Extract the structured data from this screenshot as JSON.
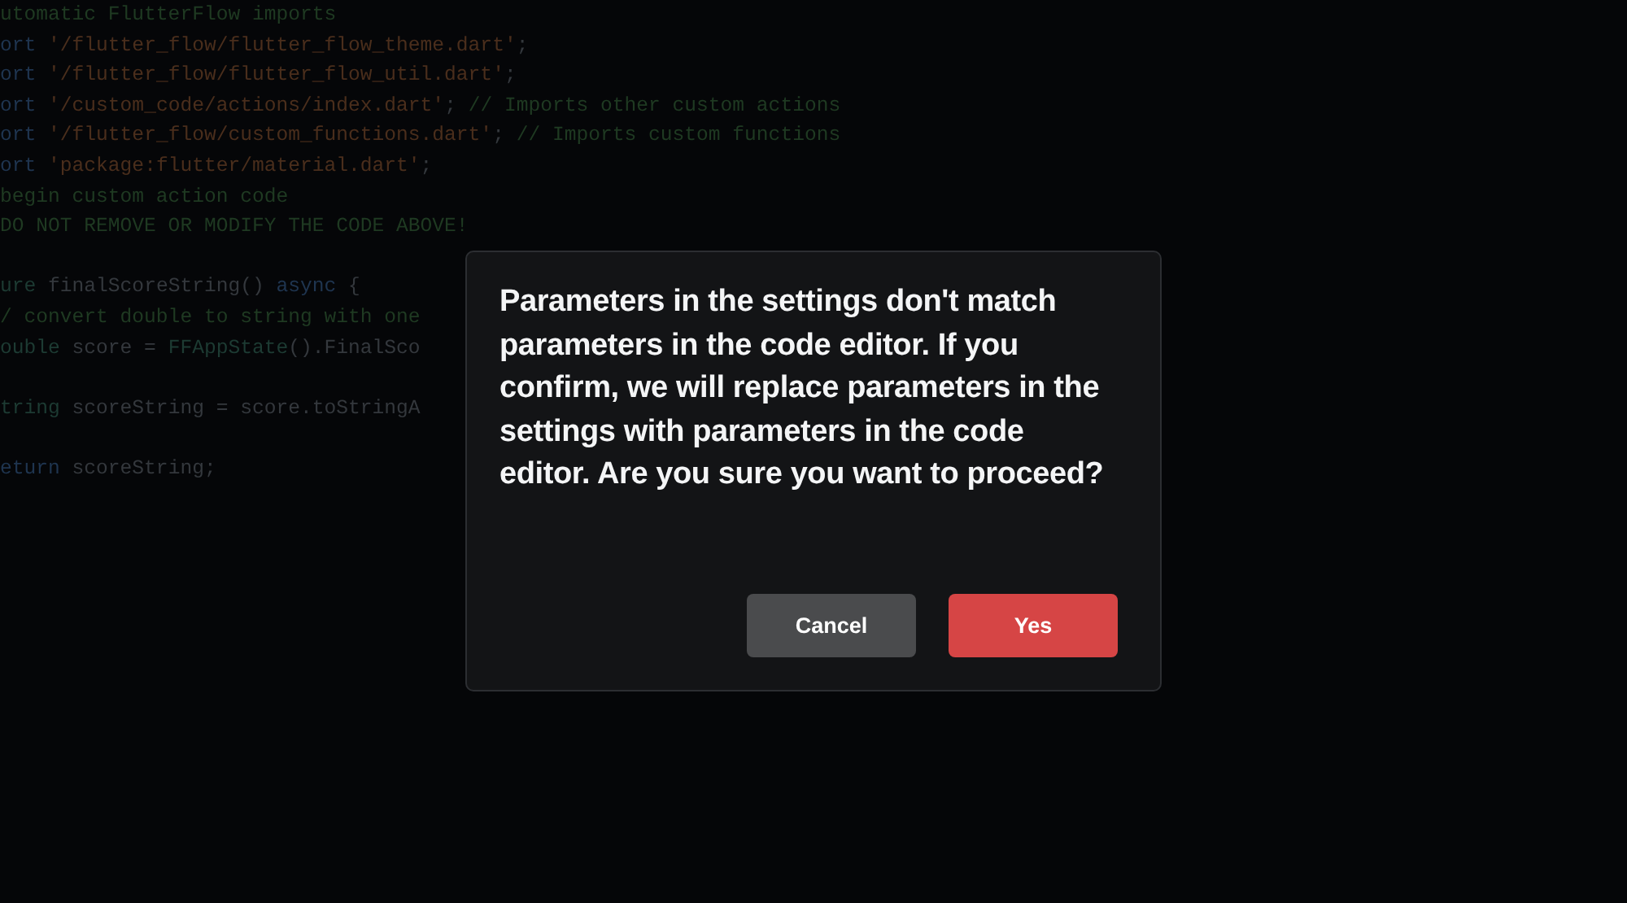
{
  "code_lines": [
    {
      "kind": "code",
      "segments": [
        {
          "kind": "comment",
          "text": "utomatic FlutterFlow imports"
        }
      ]
    },
    {
      "kind": "code",
      "segments": [
        {
          "kind": "keyword",
          "text": "ort "
        },
        {
          "kind": "string",
          "text": "'/flutter_flow/flutter_flow_theme.dart'"
        },
        {
          "kind": "plain",
          "text": ";"
        }
      ]
    },
    {
      "kind": "code",
      "segments": [
        {
          "kind": "keyword",
          "text": "ort "
        },
        {
          "kind": "string",
          "text": "'/flutter_flow/flutter_flow_util.dart'"
        },
        {
          "kind": "plain",
          "text": ";"
        }
      ]
    },
    {
      "kind": "code",
      "segments": [
        {
          "kind": "keyword",
          "text": "ort "
        },
        {
          "kind": "string",
          "text": "'/custom_code/actions/index.dart'"
        },
        {
          "kind": "plain",
          "text": "; "
        },
        {
          "kind": "comment",
          "text": "// Imports other custom actions"
        }
      ]
    },
    {
      "kind": "code",
      "segments": [
        {
          "kind": "keyword",
          "text": "ort "
        },
        {
          "kind": "string",
          "text": "'/flutter_flow/custom_functions.dart'"
        },
        {
          "kind": "plain",
          "text": "; "
        },
        {
          "kind": "comment",
          "text": "// Imports custom functions"
        }
      ]
    },
    {
      "kind": "code",
      "segments": [
        {
          "kind": "keyword",
          "text": "ort "
        },
        {
          "kind": "string",
          "text": "'package:flutter/material.dart'"
        },
        {
          "kind": "plain",
          "text": ";"
        }
      ]
    },
    {
      "kind": "code",
      "segments": [
        {
          "kind": "comment",
          "text": "begin custom action code"
        }
      ]
    },
    {
      "kind": "code",
      "segments": [
        {
          "kind": "comment",
          "text": "DO NOT REMOVE OR MODIFY THE CODE ABOVE!"
        }
      ]
    },
    {
      "kind": "blank"
    },
    {
      "kind": "code",
      "segments": [
        {
          "kind": "type",
          "text": "ure "
        },
        {
          "kind": "plain",
          "text": "finalScoreString() "
        },
        {
          "kind": "keyword",
          "text": "async"
        },
        {
          "kind": "plain",
          "text": " {"
        }
      ]
    },
    {
      "kind": "code",
      "segments": [
        {
          "kind": "comment",
          "text": "/ convert double to string with one"
        }
      ]
    },
    {
      "kind": "code",
      "segments": [
        {
          "kind": "type",
          "text": "ouble "
        },
        {
          "kind": "plain",
          "text": "score = "
        },
        {
          "kind": "type",
          "text": "FFAppState"
        },
        {
          "kind": "plain",
          "text": "().FinalSco"
        }
      ]
    },
    {
      "kind": "blank"
    },
    {
      "kind": "code",
      "segments": [
        {
          "kind": "type",
          "text": "tring "
        },
        {
          "kind": "plain",
          "text": "scoreString = score.toStringA"
        }
      ]
    },
    {
      "kind": "blank"
    },
    {
      "kind": "code",
      "segments": [
        {
          "kind": "keyword",
          "text": "eturn "
        },
        {
          "kind": "plain",
          "text": "scoreString;"
        }
      ]
    }
  ],
  "dialog": {
    "message": "Parameters in the settings don't match parameters in the code editor. If you confirm, we will replace parameters in the settings with parameters in the code editor. Are you sure you want to proceed?",
    "buttons": [
      {
        "kind": "secondary",
        "label": "Cancel"
      },
      {
        "kind": "primary",
        "label": "Yes"
      }
    ]
  }
}
